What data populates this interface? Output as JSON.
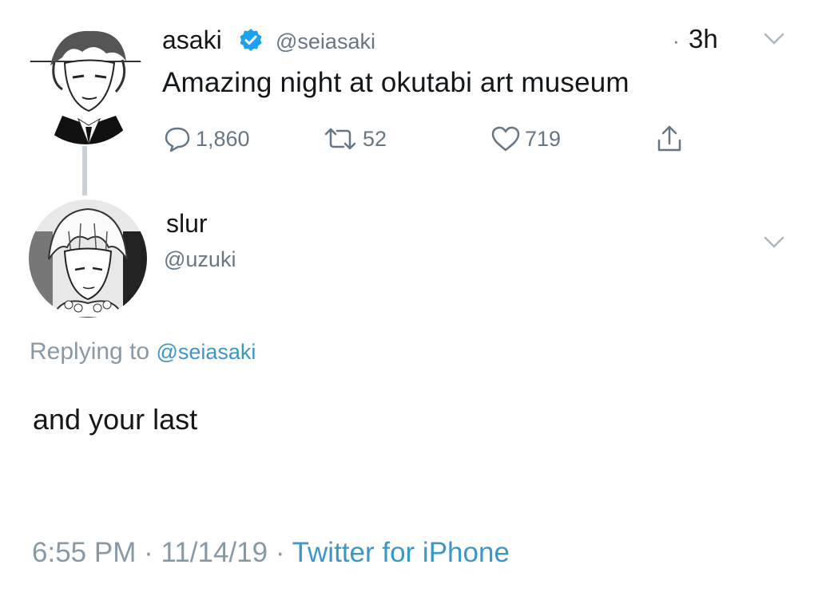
{
  "parent_tweet": {
    "display_name": "asaki",
    "handle": "@seiasaki",
    "time_separator": "·",
    "time": "3h",
    "text": "Amazing night at okutabi art museum",
    "replies": "1,860",
    "retweets": "52",
    "likes": "719",
    "verified_color": "#1da1f2"
  },
  "reply_tweet": {
    "display_name": "slur",
    "handle": "@uzuki",
    "replying_to_label": "Replying to",
    "replying_to_handle": "@seiasaki",
    "text": "and your last",
    "timestamp": "6:55 PM · 11/14/19 · ",
    "source": "Twitter for iPhone"
  },
  "icons": {
    "reply": "reply-bubble-icon",
    "retweet": "retweet-arrows-icon",
    "like": "heart-icon",
    "share": "share-upload-icon",
    "menu": "chevron-down-icon"
  },
  "colors": {
    "link": "#3d96c8",
    "muted": "#657786",
    "text": "#14171a"
  }
}
